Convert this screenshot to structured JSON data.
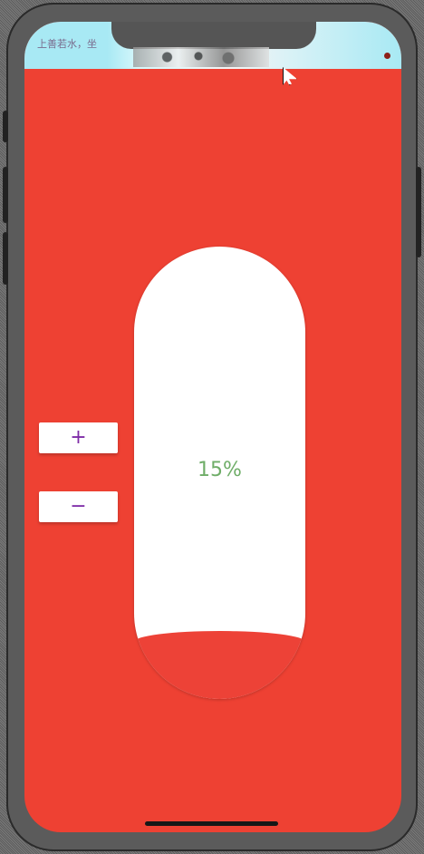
{
  "status_bar": {
    "text": "上善若水，坐"
  },
  "controls": {
    "increase_label": "+",
    "decrease_label": "−"
  },
  "gauge": {
    "label": "15%",
    "level": 0.15
  },
  "colors": {
    "background": "#ee4133",
    "button_text": "#7e2ca7",
    "gauge_text": "#6fad68",
    "gauge_fill": "#ed4237",
    "gauge_background": "#ffffff"
  },
  "icons": {
    "increase": "plus-icon",
    "decrease": "minus-icon",
    "pointer": "mouse-pointer-icon"
  }
}
